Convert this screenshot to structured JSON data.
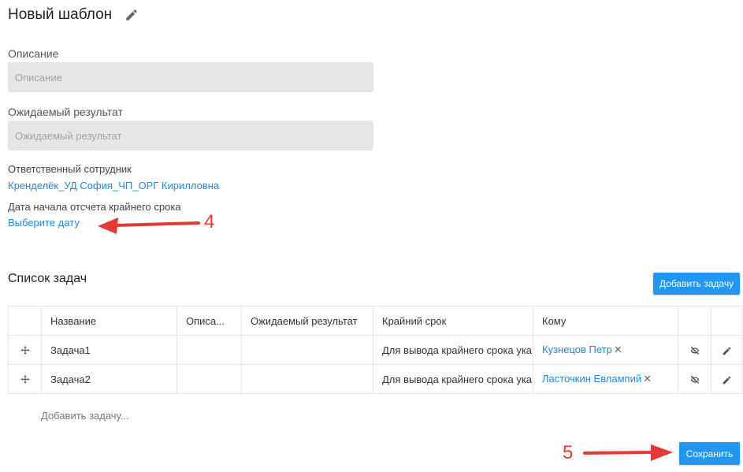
{
  "header": {
    "title": "Новый шаблон",
    "edit_icon": "pencil-icon"
  },
  "description": {
    "label": "Описание",
    "placeholder": "Описание",
    "value": ""
  },
  "expected_result": {
    "label": "Ожидаемый результат",
    "placeholder": "Ожидаемый результат",
    "value": ""
  },
  "responsible": {
    "label": "Ответственный сотрудник",
    "value": "Кренделёк_УД София_ЧП_ОРГ Кирилловна"
  },
  "start_date": {
    "label": "Дата начала отсчета крайнего срока",
    "link": "Выберите дату"
  },
  "annotations": {
    "arrow_4": "4",
    "arrow_5": "5",
    "color": "#e53935"
  },
  "task_list": {
    "title": "Список задач",
    "add_button": "Добавить задачу",
    "columns": [
      "",
      "Название",
      "Описа...",
      "Ожидаемый результат",
      "Крайний срок",
      "Кому",
      "",
      ""
    ],
    "rows": [
      {
        "name": "Задача1",
        "description": "",
        "expected": "",
        "deadline": "Для вывода крайнего срока ука",
        "assignee": "Кузнецов Петр",
        "remove": "✕"
      },
      {
        "name": "Задача2",
        "description": "",
        "expected": "",
        "deadline": "Для вывода крайнего срока ука",
        "assignee": "Ласточкин Евлампий",
        "remove": "✕"
      }
    ],
    "row_icons": {
      "drag": "move-icon",
      "visibility": "eye-off-icon",
      "edit": "pencil-icon"
    },
    "add_task_placeholder": "Добавить задачу..."
  },
  "save_button": "Сохранить",
  "colors": {
    "accent": "#2196f3",
    "link": "#1e88e5",
    "input_bg": "#e6e6e6"
  }
}
